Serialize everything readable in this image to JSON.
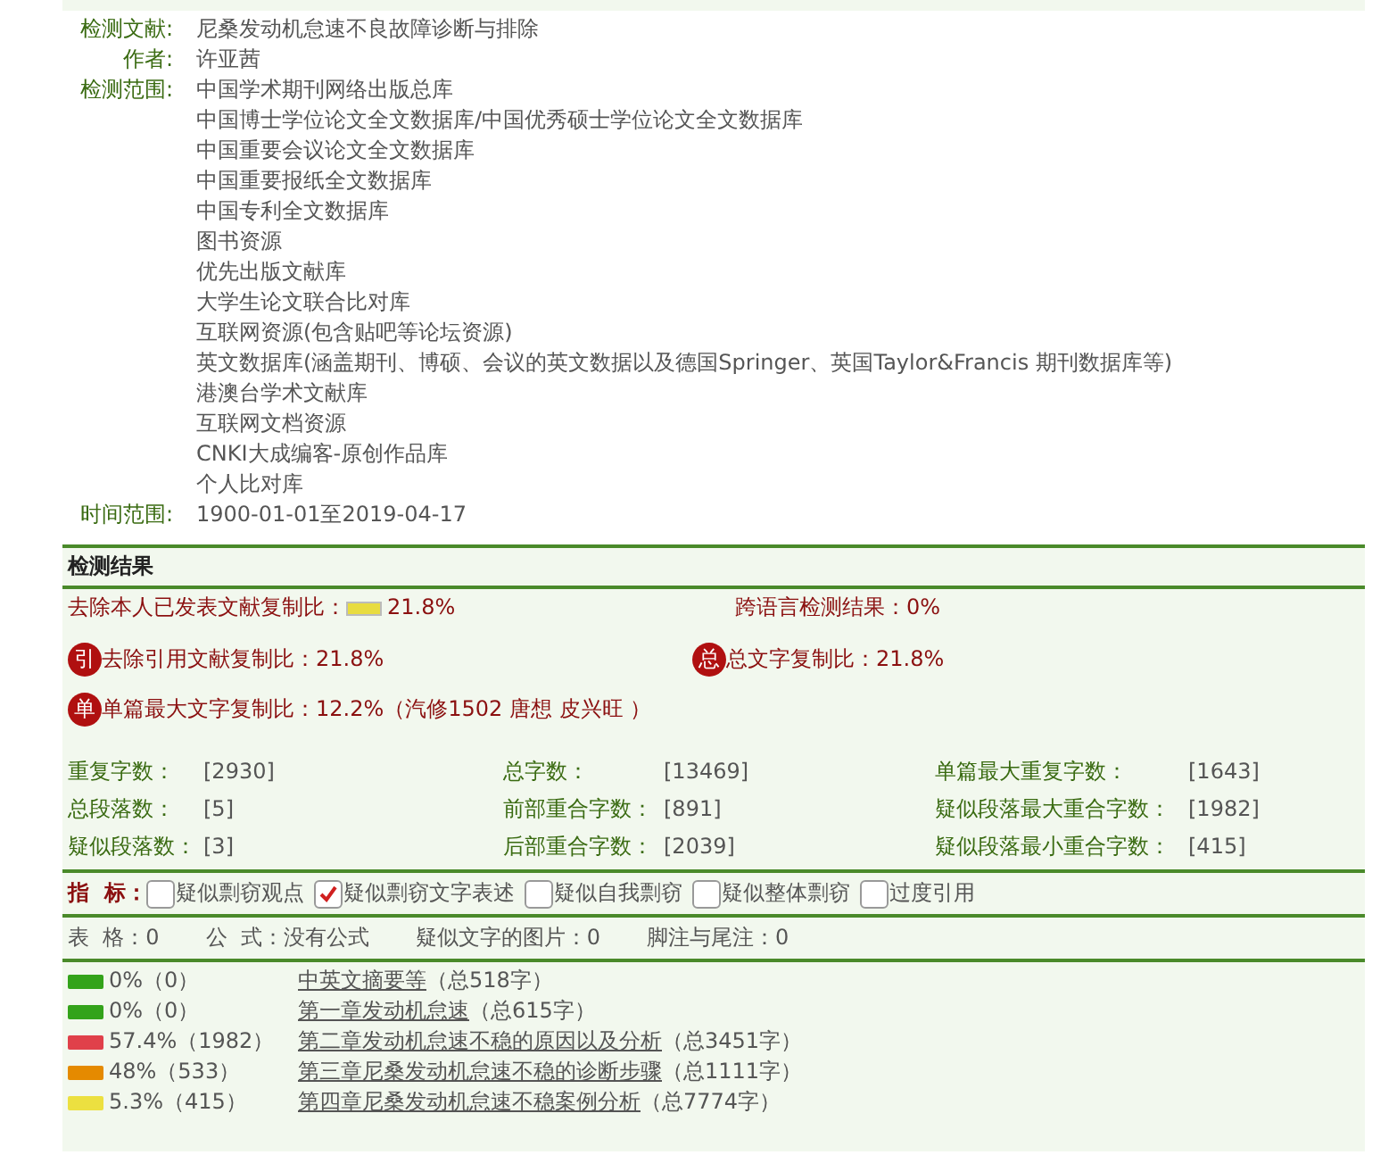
{
  "info": [
    {
      "label": "检测文献:",
      "values": [
        "尼桑发动机怠速不良故障诊断与排除"
      ]
    },
    {
      "label": "作者:",
      "values": [
        "许亚茜"
      ]
    },
    {
      "label": "检测范围:",
      "values": [
        "中国学术期刊网络出版总库",
        "中国博士学位论文全文数据库/中国优秀硕士学位论文全文数据库",
        "中国重要会议论文全文数据库",
        "中国重要报纸全文数据库",
        "中国专利全文数据库",
        "图书资源",
        "优先出版文献库",
        "大学生论文联合比对库",
        "互联网资源(包含贴吧等论坛资源)",
        "英文数据库(涵盖期刊、博硕、会议的英文数据以及德国Springer、英国Taylor&Francis 期刊数据库等)",
        "港澳台学术文献库",
        "互联网文档资源",
        "CNKI大成编客-原创作品库",
        "个人比对库"
      ]
    },
    {
      "label": "时间范围:",
      "values": [
        "1900-01-01至2019-04-17"
      ]
    }
  ],
  "results": {
    "title": "检测结果",
    "self_exclusion": {
      "label": "去除本人已发表文献复制比：",
      "value": "21.8%"
    },
    "cross_language": "跨语言检测结果：0%",
    "ratios": [
      {
        "badge": "引",
        "text": "去除引用文献复制比：21.8%"
      },
      {
        "badge": "总",
        "text": "总文字复制比：21.8%"
      },
      {
        "badge": "单",
        "text": "单篇最大文字复制比：12.2%（汽修1502 唐想 皮兴旺 ）"
      }
    ],
    "stats": [
      {
        "label": "重复字数：",
        "value": "[2930]"
      },
      {
        "label": "总字数：",
        "value": "[13469]"
      },
      {
        "label": "单篇最大重复字数：",
        "value": "[1643]"
      },
      {
        "label": "总段落数：",
        "value": "[5]"
      },
      {
        "label": "前部重合字数：",
        "value": "[891]"
      },
      {
        "label": "疑似段落最大重合字数：",
        "value": "[1982]"
      },
      {
        "label": "疑似段落数：",
        "value": "[3]"
      },
      {
        "label": "后部重合字数：",
        "value": "[2039]"
      },
      {
        "label": "疑似段落最小重合字数：",
        "value": "[415]"
      }
    ],
    "indicator_label": "指  标：",
    "indicators": [
      {
        "label": "疑似剽窃观点",
        "checked": false
      },
      {
        "label": "疑似剽窃文字表述",
        "checked": true
      },
      {
        "label": "疑似自我剽窃",
        "checked": false
      },
      {
        "label": "疑似整体剽窃",
        "checked": false
      },
      {
        "label": "过度引用",
        "checked": false
      }
    ],
    "counts": [
      "表  格：0",
      "公  式：没有公式",
      "疑似文字的图片：0",
      "脚注与尾注：0"
    ],
    "chapters": [
      {
        "percent": "0%（0）",
        "title": "中英文摘要等",
        "total": "（总518字）",
        "color": "#33a31a"
      },
      {
        "percent": "0%（0）",
        "title": "第一章发动机怠速",
        "total": "（总615字）",
        "color": "#33a31a"
      },
      {
        "percent": "57.4%（1982）",
        "title": "第二章发动机怠速不稳的原因以及分析",
        "total": "（总3451字）",
        "color": "#e0404a"
      },
      {
        "percent": "48%（533）",
        "title": "第三章尼桑发动机怠速不稳的诊断步骤",
        "total": "（总1111字）",
        "color": "#e58a00"
      },
      {
        "percent": "5.3%（415）",
        "title": "第四章尼桑发动机怠速不稳案例分析",
        "total": "（总7774字）",
        "color": "#ece040"
      }
    ]
  }
}
